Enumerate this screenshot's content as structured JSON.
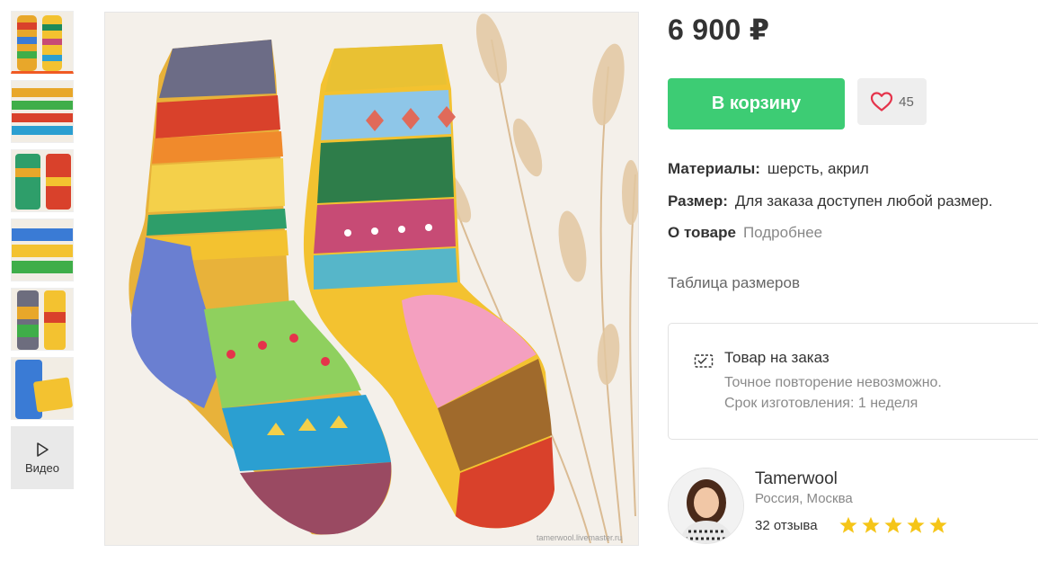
{
  "product": {
    "price": "6 900 ₽",
    "cart_label": "В корзину",
    "favorites_count": "45",
    "materials_label": "Материалы:",
    "materials_value": "шерсть, акрил",
    "size_label": "Размер:",
    "size_value": "Для заказа доступен любой размер.",
    "about_label": "О товаре",
    "about_link": "Подробнее",
    "size_table_link": "Таблица размеров"
  },
  "order": {
    "title": "Товар на заказ",
    "line1": "Точное повторение невозможно.",
    "line2": "Срок изготовления: 1 неделя"
  },
  "seller": {
    "name": "Tamerwool",
    "location": "Россия, Москва",
    "reviews": "32 отзыва",
    "rating": 5
  },
  "gallery": {
    "video_label": "Видео",
    "watermark": "tamerwool.livemaster.ru"
  },
  "colors": {
    "cart": "#3dcc74",
    "star": "#f5c518",
    "heart": "#e5334b",
    "thumb_active": "#f05a23"
  }
}
